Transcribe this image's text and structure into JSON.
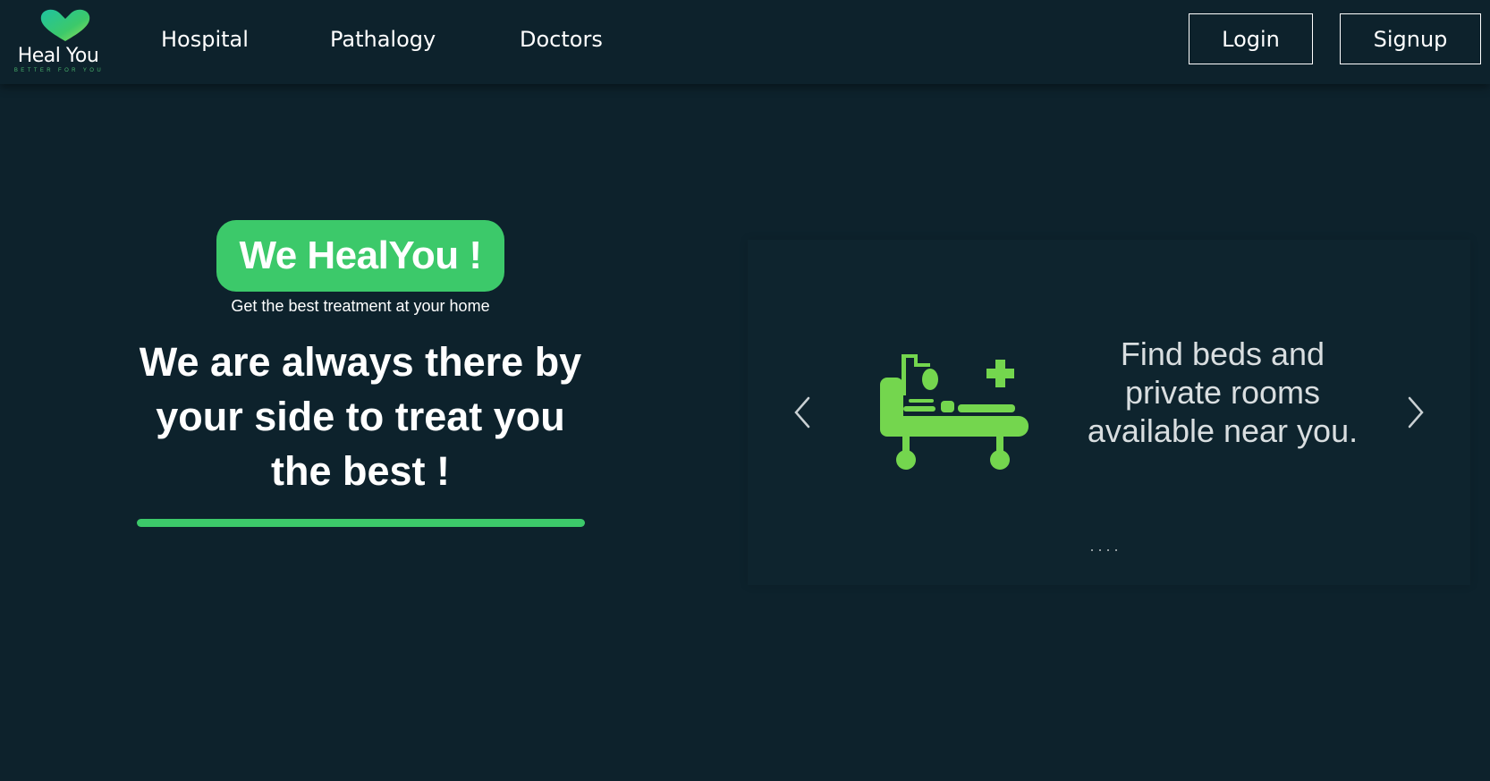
{
  "brand": {
    "name": "Heal You",
    "tagline": "BETTER FOR YOU",
    "logo_icon": "heart-icon",
    "accent_color": "#3cc96a"
  },
  "nav": {
    "links": [
      "Hospital",
      "Pathalogy",
      "Doctors"
    ],
    "login_label": "Login",
    "signup_label": "Signup"
  },
  "hero": {
    "badge": "We HealYou !",
    "tagline": "Get the best treatment at your home",
    "headline": "We are always there by your side to treat you the best !"
  },
  "carousel": {
    "slide_icon": "hospital-bed-icon",
    "slide_text": "Find beds and private rooms available near you.",
    "prev_icon": "chevron-left-icon",
    "next_icon": "chevron-right-icon",
    "slide_count": 4
  },
  "colors": {
    "background": "#0d222c",
    "accent": "#3cc96a",
    "icon_green": "#74d64e"
  }
}
